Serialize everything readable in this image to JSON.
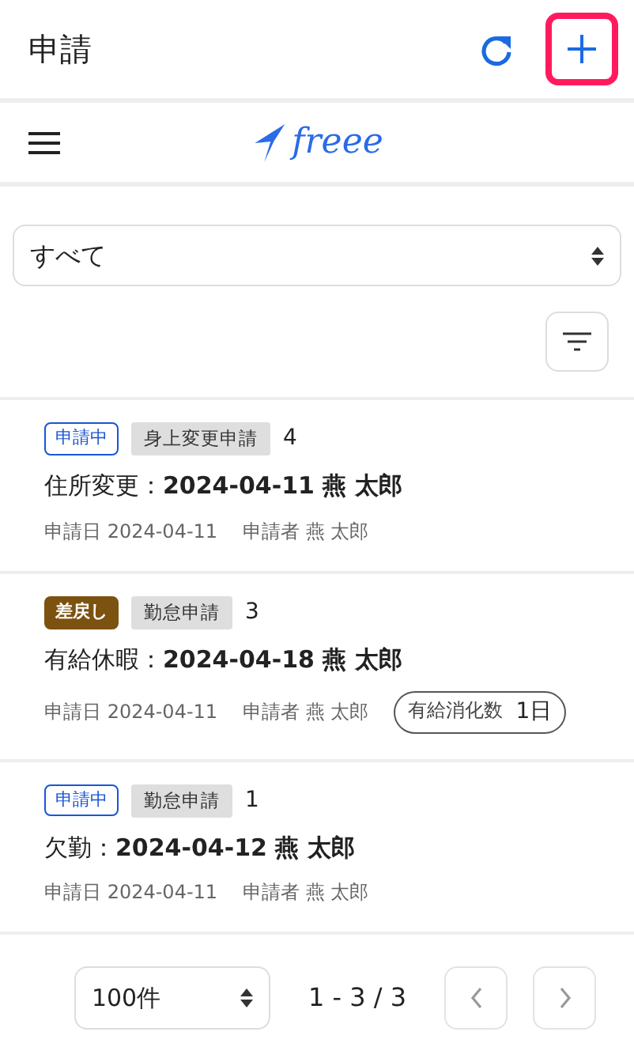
{
  "header": {
    "title": "申請",
    "add_highlighted": true
  },
  "navbar": {
    "logo": "freee"
  },
  "filter_select": {
    "value": "すべて"
  },
  "requests": [
    {
      "kind": "pending",
      "status": "申請中",
      "category": "身上変更申請",
      "count": "4",
      "title_prefix": "住所変更：",
      "title_main": "2024-04-11 燕 太郎",
      "date_label": "申請日",
      "date": "2024-04-11",
      "applicant_label": "申請者",
      "applicant": "燕 太郎"
    },
    {
      "kind": "returned",
      "status": "差戻し",
      "category": "勤怠申請",
      "count": "3",
      "title_prefix": "有給休暇：",
      "title_main": "2024-04-18 燕 太郎",
      "date_label": "申請日",
      "date": "2024-04-11",
      "applicant_label": "申請者",
      "applicant": "燕 太郎",
      "extra_label": "有給消化数",
      "extra_value": "1日"
    },
    {
      "kind": "pending",
      "status": "申請中",
      "category": "勤怠申請",
      "count": "1",
      "title_prefix": "欠勤：",
      "title_main": "2024-04-12 燕 太郎",
      "date_label": "申請日",
      "date": "2024-04-11",
      "applicant_label": "申請者",
      "applicant": "燕 太郎"
    }
  ],
  "pagination": {
    "per_page": "100件",
    "range": "1 - 3 / 3",
    "prev_disabled": true,
    "next_disabled": true
  }
}
